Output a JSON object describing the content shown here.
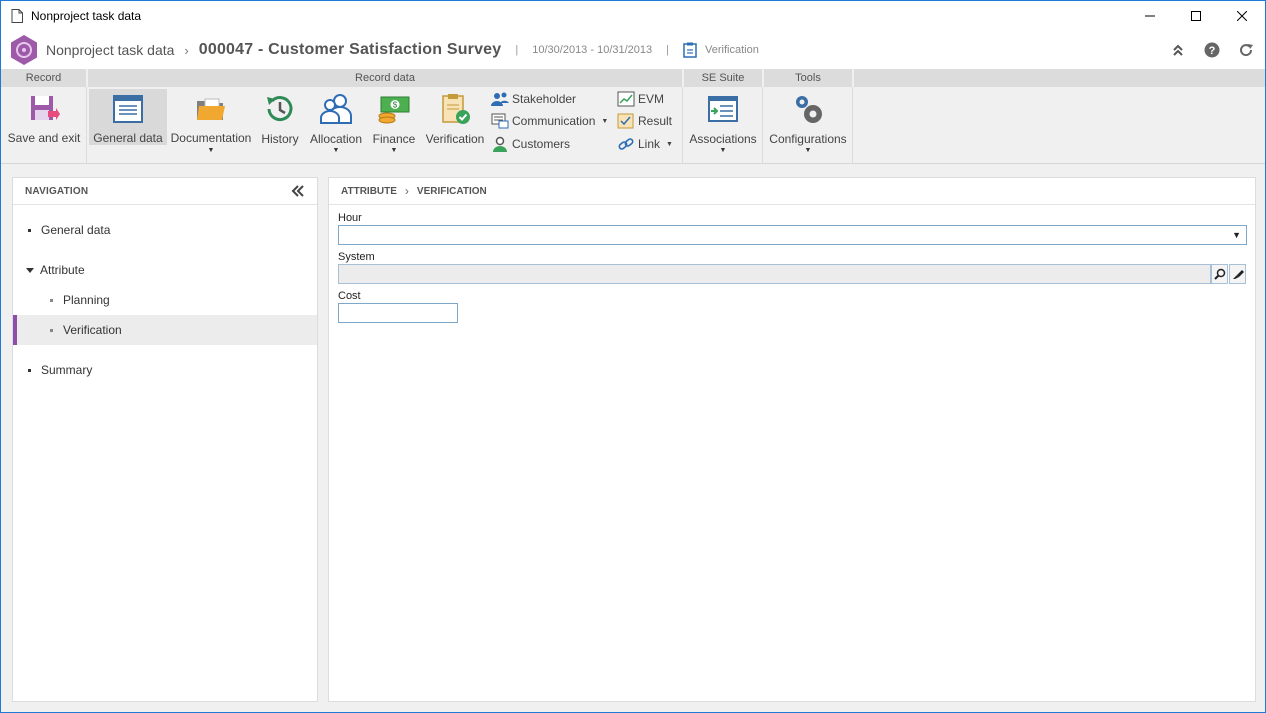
{
  "window": {
    "title": "Nonproject task data"
  },
  "header": {
    "root": "Nonproject task data",
    "record_title": "000047 - Customer Satisfaction Survey",
    "date_range": "10/30/2013 - 10/31/2013",
    "status": "Verification"
  },
  "ribbon": {
    "groups": {
      "record": "Record",
      "record_data": "Record data",
      "se_suite": "SE Suite",
      "tools": "Tools"
    },
    "buttons": {
      "save_exit": "Save and exit",
      "general_data": "General data",
      "documentation": "Documentation",
      "history": "History",
      "allocation": "Allocation",
      "finance": "Finance",
      "verification": "Verification",
      "stakeholder": "Stakeholder",
      "communication": "Communication",
      "customers": "Customers",
      "evm": "EVM",
      "result": "Result",
      "link": "Link",
      "associations": "Associations",
      "configurations": "Configurations"
    }
  },
  "navigation": {
    "title": "NAVIGATION",
    "items": [
      "General data",
      "Attribute",
      "Planning",
      "Verification",
      "Summary"
    ]
  },
  "main": {
    "breadcrumb": [
      "ATTRIBUTE",
      "VERIFICATION"
    ],
    "fields": {
      "hour_label": "Hour",
      "system_label": "System",
      "cost_label": "Cost"
    }
  },
  "colors": {
    "accent": "#8c4ea8",
    "window_border": "#1e7ad6",
    "input_border": "#7fa7c9"
  }
}
